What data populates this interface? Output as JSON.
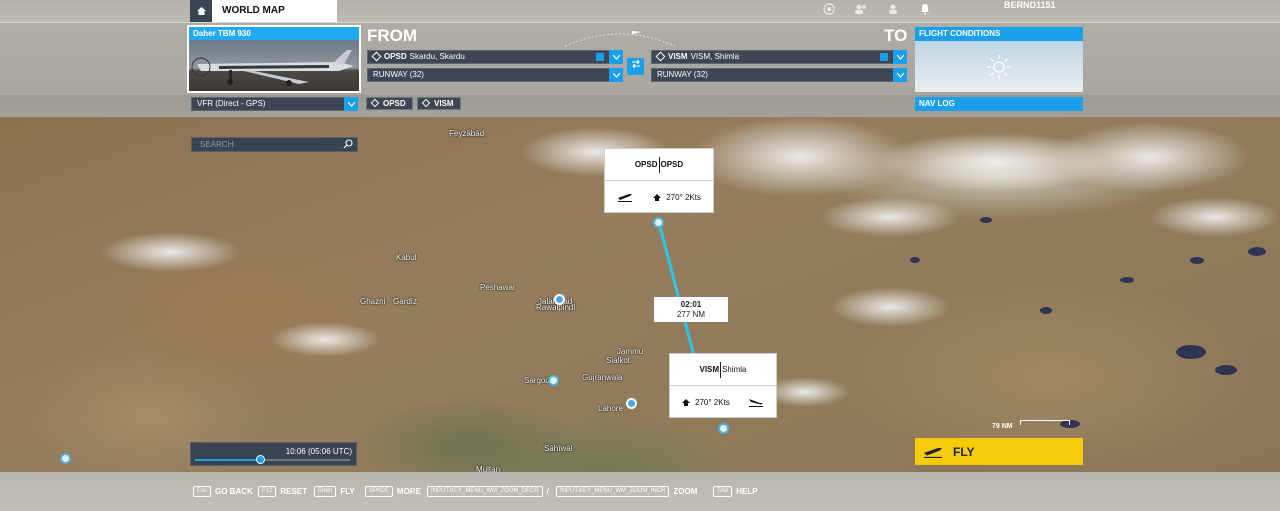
{
  "topbar": {
    "world_map_label": "WORLD MAP",
    "username": "BERND1151",
    "icons": [
      "home-icon",
      "target-icon",
      "friends-icon",
      "user-icon",
      "notification-icon"
    ]
  },
  "aircraft": {
    "name": "Daher TBM 930"
  },
  "from": {
    "label": "FROM",
    "airport_code": "OPSD",
    "airport_name": "Skardu, Skardu",
    "runway": "RUNWAY (32)"
  },
  "to": {
    "label": "TO",
    "airport_code": "VISM",
    "airport_name": "VISM, Shimla",
    "runway": "RUNWAY (32)"
  },
  "flight_conditions": {
    "title": "FLIGHT CONDITIONS",
    "icon": "sun-icon"
  },
  "flight_plan": {
    "type": "VFR (Direct - GPS)",
    "waypoints": [
      "OPSD",
      "VISM"
    ]
  },
  "nav_log": {
    "title": "NAV LOG"
  },
  "map": {
    "search_placeholder": "SEARCH",
    "cities": [
      "Feyzābād",
      "Kabul",
      "Peshawar",
      "Ghazni",
      "Gardīz",
      "Jalalabad",
      "Rawalpindi",
      "Jammu",
      "Sialkot",
      "Sargodha",
      "Gujranwala",
      "Lahore",
      "Sāhīwāl",
      "Multan"
    ],
    "origin_card": {
      "code": "OPSD",
      "name": "OPSD",
      "wind": "270° 2Kts"
    },
    "destination_card": {
      "code": "VISM",
      "name": "Shimla",
      "wind": "270° 2Kts"
    },
    "route": {
      "time": "02:01",
      "distance": "277 NM",
      "color": "#29c7e8"
    },
    "time_of_day": {
      "label": "10:06 (05:06 UTC)",
      "progress": 0.42
    },
    "scale_label": "79 NM",
    "fly_label": "FLY"
  },
  "hints": [
    {
      "key": "Esc",
      "label": "GO BACK"
    },
    {
      "key": "F12",
      "label": "RESET"
    },
    {
      "key": "Enter",
      "label": "FLY"
    },
    {
      "key": "SPACE",
      "label": "MORE"
    },
    {
      "key": "INPUT.KEY_MENU_WM_ZOOM_DECR",
      "label": "/"
    },
    {
      "key": "INPUT.KEY_MENU_WM_ZOOM_INCR",
      "label": "ZOOM"
    },
    {
      "key": "TAB",
      "label": "HELP"
    }
  ],
  "colors": {
    "accent": "#1aa0ea",
    "fly_button": "#f6cb0b",
    "panel_dark": "#3d4652"
  }
}
